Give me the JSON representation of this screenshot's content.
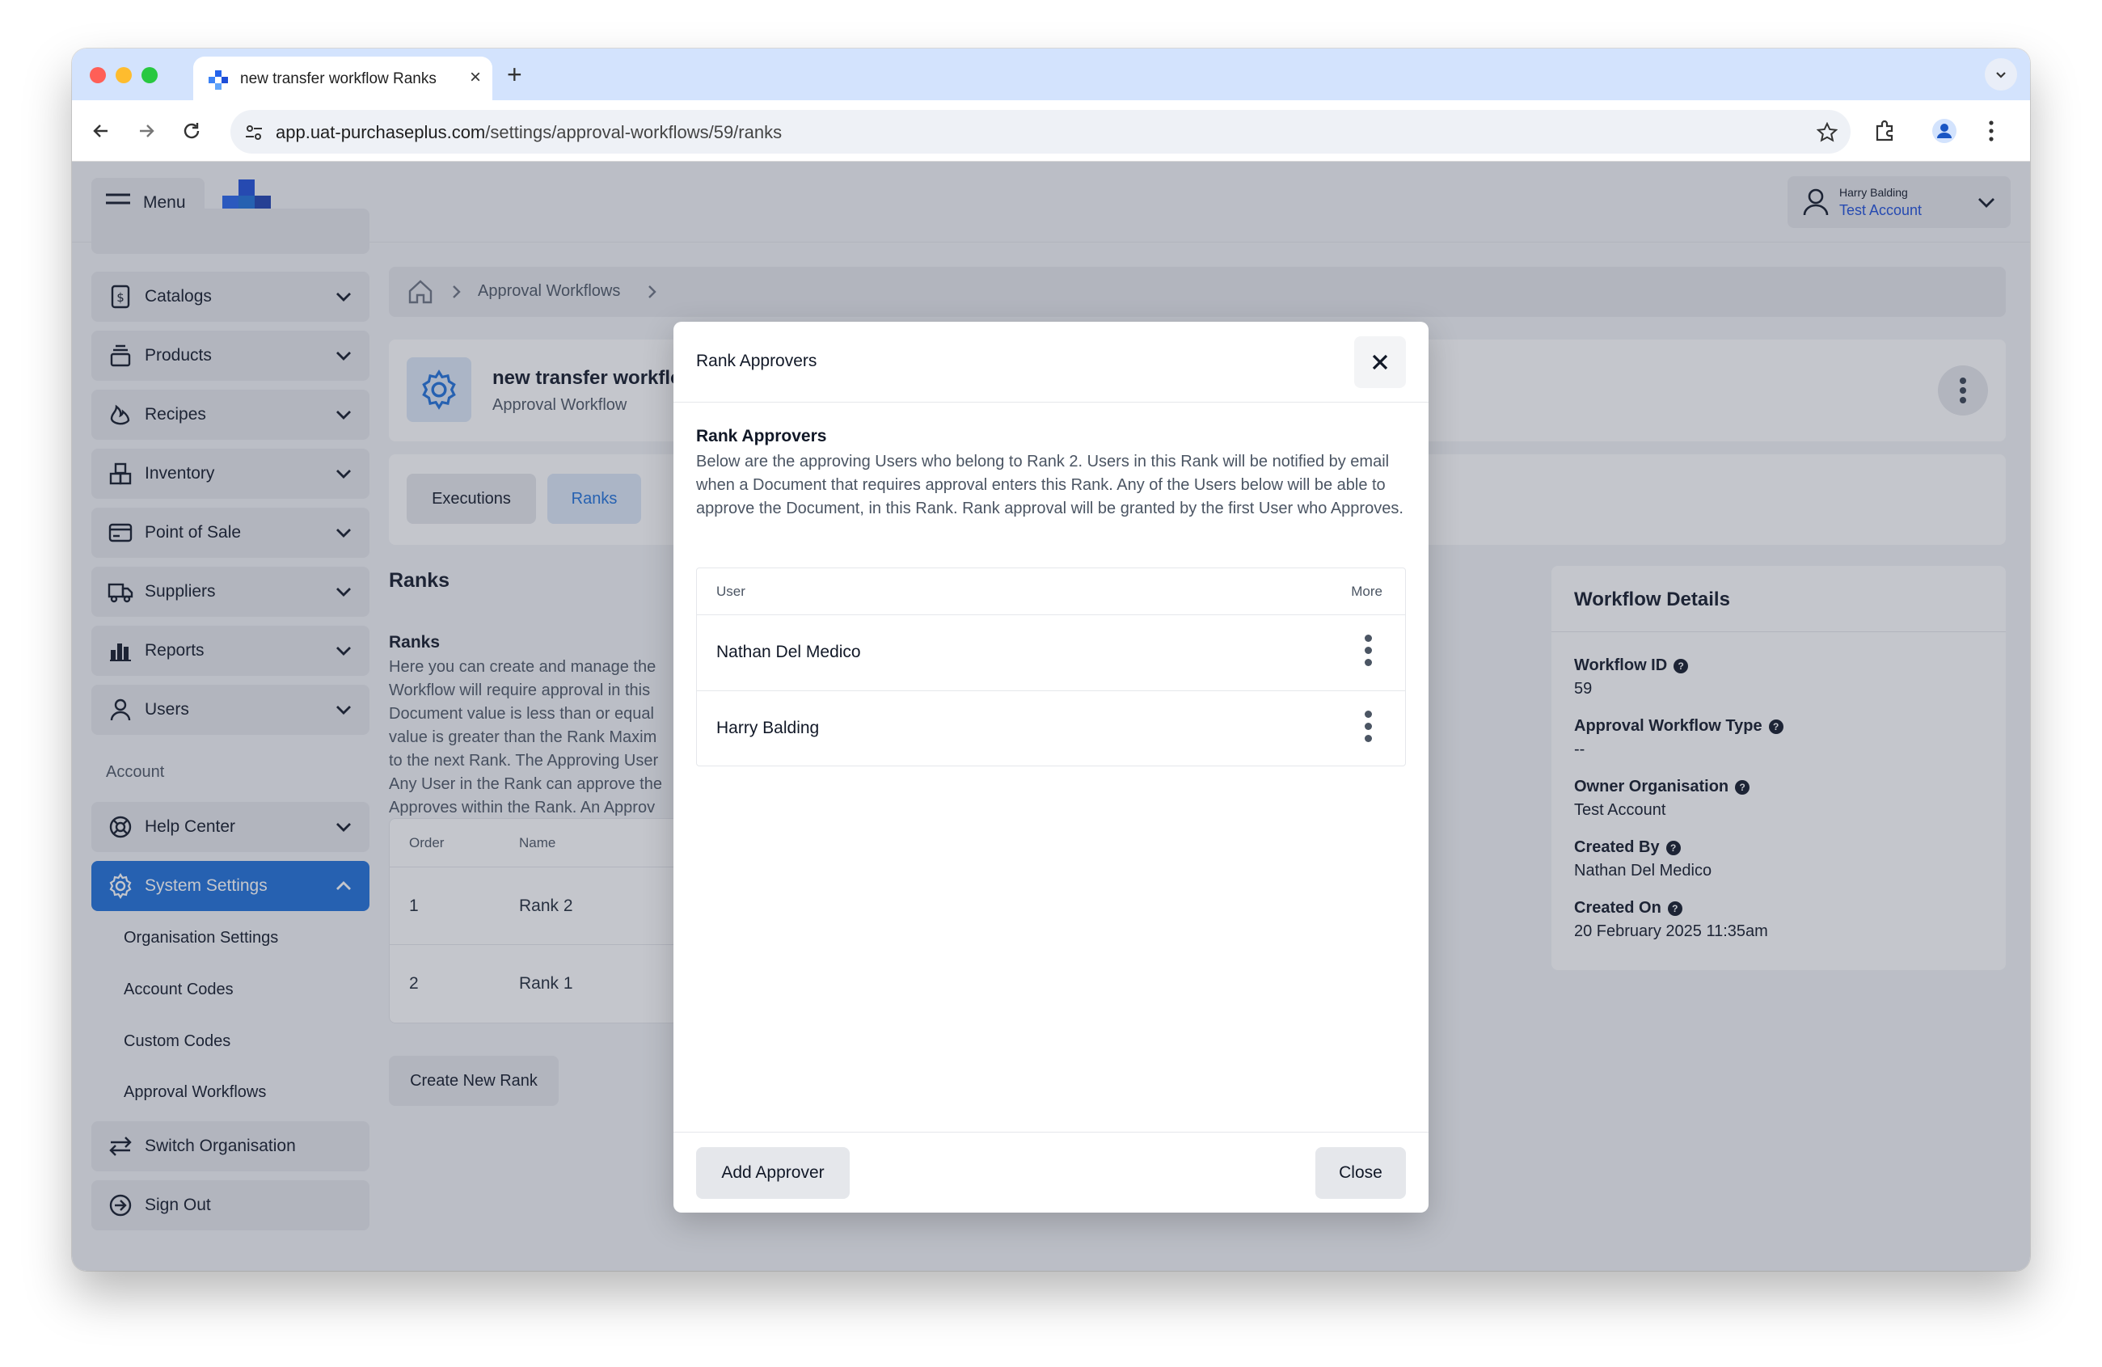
{
  "browser": {
    "tab_title": "new transfer workflow Ranks",
    "url_domain": "app.uat-purchaseplus.com",
    "url_path": "/settings/approval-workflows/59/ranks",
    "tab_close": "×",
    "new_tab": "+"
  },
  "topbar": {
    "menu_label": "Menu",
    "user_name": "Harry Balding",
    "user_account": "Test Account"
  },
  "sidebar": {
    "items": [
      {
        "label": "Catalogs",
        "icon": "dollar-doc-icon"
      },
      {
        "label": "Products",
        "icon": "stack-icon"
      },
      {
        "label": "Recipes",
        "icon": "flame-icon"
      },
      {
        "label": "Inventory",
        "icon": "boxes-icon"
      },
      {
        "label": "Point of Sale",
        "icon": "card-icon"
      },
      {
        "label": "Suppliers",
        "icon": "truck-icon"
      },
      {
        "label": "Reports",
        "icon": "bar-chart-icon"
      },
      {
        "label": "Users",
        "icon": "user-icon"
      }
    ],
    "account_section": "Account",
    "help_center": "Help Center",
    "system_settings": "System Settings",
    "sub_items": [
      "Organisation Settings",
      "Account Codes",
      "Custom Codes",
      "Approval Workflows"
    ],
    "switch_org": "Switch Organisation",
    "sign_out": "Sign Out"
  },
  "main": {
    "breadcrumb": "Approval Workflows",
    "workflow_title": "new transfer workflo",
    "workflow_subtitle": "Approval Workflow",
    "tabs": [
      "Executions",
      "Ranks"
    ],
    "ranks_heading": "Ranks",
    "ranks_subheading": "Ranks",
    "ranks_desc": [
      "Here you can create and manage the",
      "Workflow will require approval in this",
      "Document value is less than or equal",
      "value is greater than the Rank Maxim",
      "to the next Rank. The Approving User",
      "Any User in the Rank can approve the",
      "Approves within the Rank. An Approv"
    ],
    "table_headers": [
      "Order",
      "Name"
    ],
    "rows": [
      {
        "order": "1",
        "name": "Rank 2"
      },
      {
        "order": "2",
        "name": "Rank 1"
      }
    ],
    "create_button": "Create New Rank"
  },
  "details": {
    "heading": "Workflow Details",
    "fields": [
      {
        "label": "Workflow ID",
        "value": "59"
      },
      {
        "label": "Approval Workflow Type",
        "value": "--"
      },
      {
        "label": "Owner Organisation",
        "value": "Test Account"
      },
      {
        "label": "Created By",
        "value": "Nathan Del Medico"
      },
      {
        "label": "Created On",
        "value": "20 February 2025 11:35am"
      }
    ]
  },
  "modal": {
    "title": "Rank Approvers",
    "subheading": "Rank Approvers",
    "description": "Below are the approving Users who belong to Rank 2. Users in this Rank will be notified by email when a Document that requires approval enters this Rank. Any of the Users below will be able to approve the Document, in this Rank. Rank approval will be granted by the first User who Approves.",
    "col_user": "User",
    "col_more": "More",
    "users": [
      "Nathan Del Medico",
      "Harry Balding"
    ],
    "add_button": "Add Approver",
    "close_button": "Close"
  },
  "colors": {
    "primary": "#1d6fd8",
    "chrome_tab_bar": "#d3e3fd",
    "app_background": "#f3f4f6",
    "overlay": "rgba(60,66,85,0.30)"
  }
}
